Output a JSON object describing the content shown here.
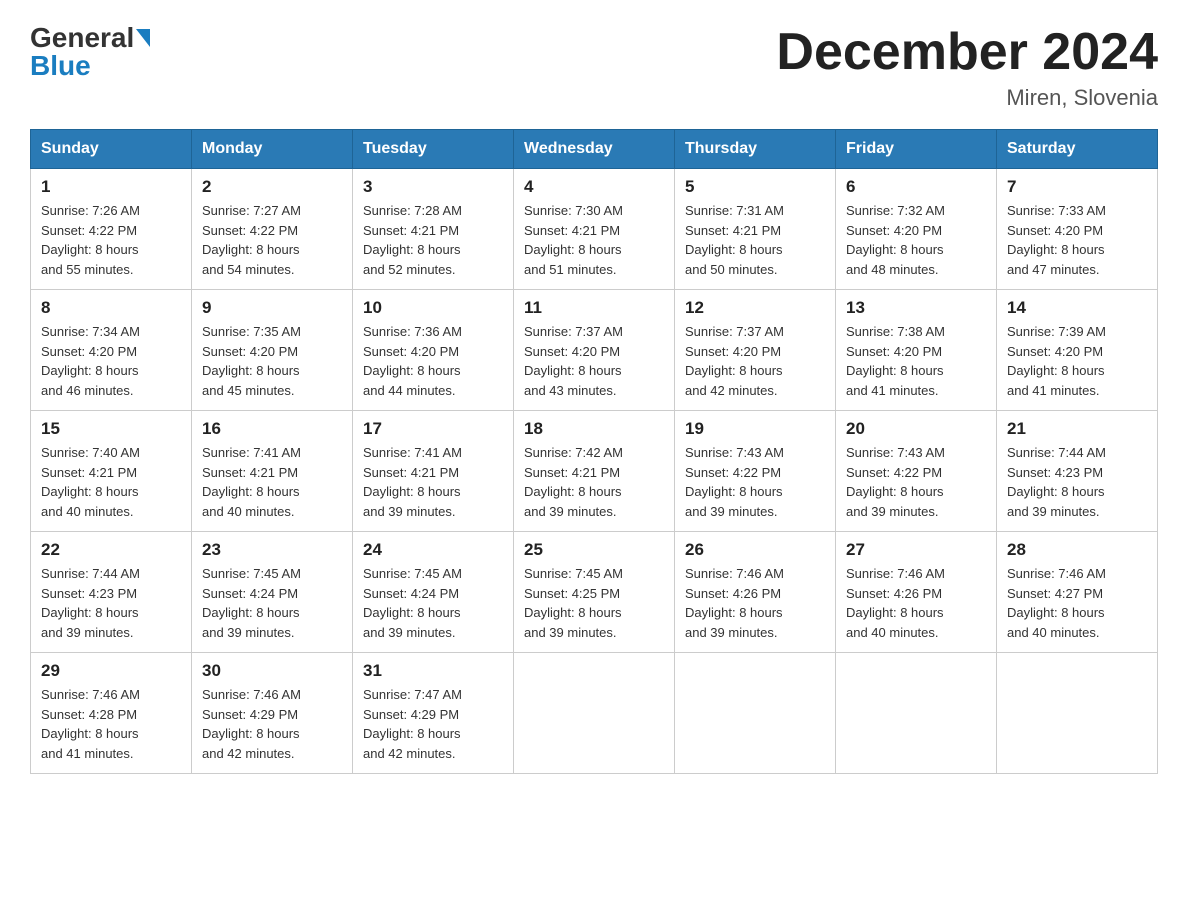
{
  "header": {
    "logo_general": "General",
    "logo_blue": "Blue",
    "month_title": "December 2024",
    "location": "Miren, Slovenia"
  },
  "days_of_week": [
    "Sunday",
    "Monday",
    "Tuesday",
    "Wednesday",
    "Thursday",
    "Friday",
    "Saturday"
  ],
  "weeks": [
    [
      {
        "day": "1",
        "sunrise": "7:26 AM",
        "sunset": "4:22 PM",
        "daylight": "8 hours and 55 minutes."
      },
      {
        "day": "2",
        "sunrise": "7:27 AM",
        "sunset": "4:22 PM",
        "daylight": "8 hours and 54 minutes."
      },
      {
        "day": "3",
        "sunrise": "7:28 AM",
        "sunset": "4:21 PM",
        "daylight": "8 hours and 52 minutes."
      },
      {
        "day": "4",
        "sunrise": "7:30 AM",
        "sunset": "4:21 PM",
        "daylight": "8 hours and 51 minutes."
      },
      {
        "day": "5",
        "sunrise": "7:31 AM",
        "sunset": "4:21 PM",
        "daylight": "8 hours and 50 minutes."
      },
      {
        "day": "6",
        "sunrise": "7:32 AM",
        "sunset": "4:20 PM",
        "daylight": "8 hours and 48 minutes."
      },
      {
        "day": "7",
        "sunrise": "7:33 AM",
        "sunset": "4:20 PM",
        "daylight": "8 hours and 47 minutes."
      }
    ],
    [
      {
        "day": "8",
        "sunrise": "7:34 AM",
        "sunset": "4:20 PM",
        "daylight": "8 hours and 46 minutes."
      },
      {
        "day": "9",
        "sunrise": "7:35 AM",
        "sunset": "4:20 PM",
        "daylight": "8 hours and 45 minutes."
      },
      {
        "day": "10",
        "sunrise": "7:36 AM",
        "sunset": "4:20 PM",
        "daylight": "8 hours and 44 minutes."
      },
      {
        "day": "11",
        "sunrise": "7:37 AM",
        "sunset": "4:20 PM",
        "daylight": "8 hours and 43 minutes."
      },
      {
        "day": "12",
        "sunrise": "7:37 AM",
        "sunset": "4:20 PM",
        "daylight": "8 hours and 42 minutes."
      },
      {
        "day": "13",
        "sunrise": "7:38 AM",
        "sunset": "4:20 PM",
        "daylight": "8 hours and 41 minutes."
      },
      {
        "day": "14",
        "sunrise": "7:39 AM",
        "sunset": "4:20 PM",
        "daylight": "8 hours and 41 minutes."
      }
    ],
    [
      {
        "day": "15",
        "sunrise": "7:40 AM",
        "sunset": "4:21 PM",
        "daylight": "8 hours and 40 minutes."
      },
      {
        "day": "16",
        "sunrise": "7:41 AM",
        "sunset": "4:21 PM",
        "daylight": "8 hours and 40 minutes."
      },
      {
        "day": "17",
        "sunrise": "7:41 AM",
        "sunset": "4:21 PM",
        "daylight": "8 hours and 39 minutes."
      },
      {
        "day": "18",
        "sunrise": "7:42 AM",
        "sunset": "4:21 PM",
        "daylight": "8 hours and 39 minutes."
      },
      {
        "day": "19",
        "sunrise": "7:43 AM",
        "sunset": "4:22 PM",
        "daylight": "8 hours and 39 minutes."
      },
      {
        "day": "20",
        "sunrise": "7:43 AM",
        "sunset": "4:22 PM",
        "daylight": "8 hours and 39 minutes."
      },
      {
        "day": "21",
        "sunrise": "7:44 AM",
        "sunset": "4:23 PM",
        "daylight": "8 hours and 39 minutes."
      }
    ],
    [
      {
        "day": "22",
        "sunrise": "7:44 AM",
        "sunset": "4:23 PM",
        "daylight": "8 hours and 39 minutes."
      },
      {
        "day": "23",
        "sunrise": "7:45 AM",
        "sunset": "4:24 PM",
        "daylight": "8 hours and 39 minutes."
      },
      {
        "day": "24",
        "sunrise": "7:45 AM",
        "sunset": "4:24 PM",
        "daylight": "8 hours and 39 minutes."
      },
      {
        "day": "25",
        "sunrise": "7:45 AM",
        "sunset": "4:25 PM",
        "daylight": "8 hours and 39 minutes."
      },
      {
        "day": "26",
        "sunrise": "7:46 AM",
        "sunset": "4:26 PM",
        "daylight": "8 hours and 39 minutes."
      },
      {
        "day": "27",
        "sunrise": "7:46 AM",
        "sunset": "4:26 PM",
        "daylight": "8 hours and 40 minutes."
      },
      {
        "day": "28",
        "sunrise": "7:46 AM",
        "sunset": "4:27 PM",
        "daylight": "8 hours and 40 minutes."
      }
    ],
    [
      {
        "day": "29",
        "sunrise": "7:46 AM",
        "sunset": "4:28 PM",
        "daylight": "8 hours and 41 minutes."
      },
      {
        "day": "30",
        "sunrise": "7:46 AM",
        "sunset": "4:29 PM",
        "daylight": "8 hours and 42 minutes."
      },
      {
        "day": "31",
        "sunrise": "7:47 AM",
        "sunset": "4:29 PM",
        "daylight": "8 hours and 42 minutes."
      },
      null,
      null,
      null,
      null
    ]
  ],
  "labels": {
    "sunrise": "Sunrise:",
    "sunset": "Sunset:",
    "daylight": "Daylight:"
  },
  "colors": {
    "header_bg": "#2a7ab5",
    "accent": "#1a7dc0"
  }
}
